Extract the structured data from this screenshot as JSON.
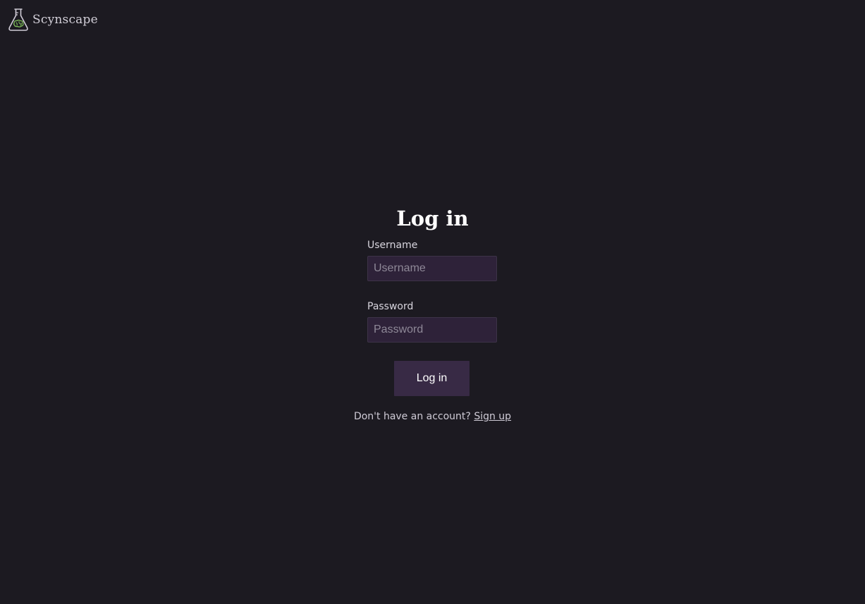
{
  "brand": {
    "name": "Scynscape",
    "icon": "flask-brain-icon",
    "icon_accent": "#7fbf5a"
  },
  "login": {
    "title": "Log in",
    "username": {
      "label": "Username",
      "placeholder": "Username",
      "value": ""
    },
    "password": {
      "label": "Password",
      "placeholder": "Password",
      "value": ""
    },
    "submit_label": "Log in",
    "signup_prompt": "Don't have an account?",
    "signup_link": "Sign up"
  },
  "colors": {
    "background": "#1c1a21",
    "input_background": "#2e2239",
    "button_background": "#382a45",
    "text": "#ffffff"
  }
}
